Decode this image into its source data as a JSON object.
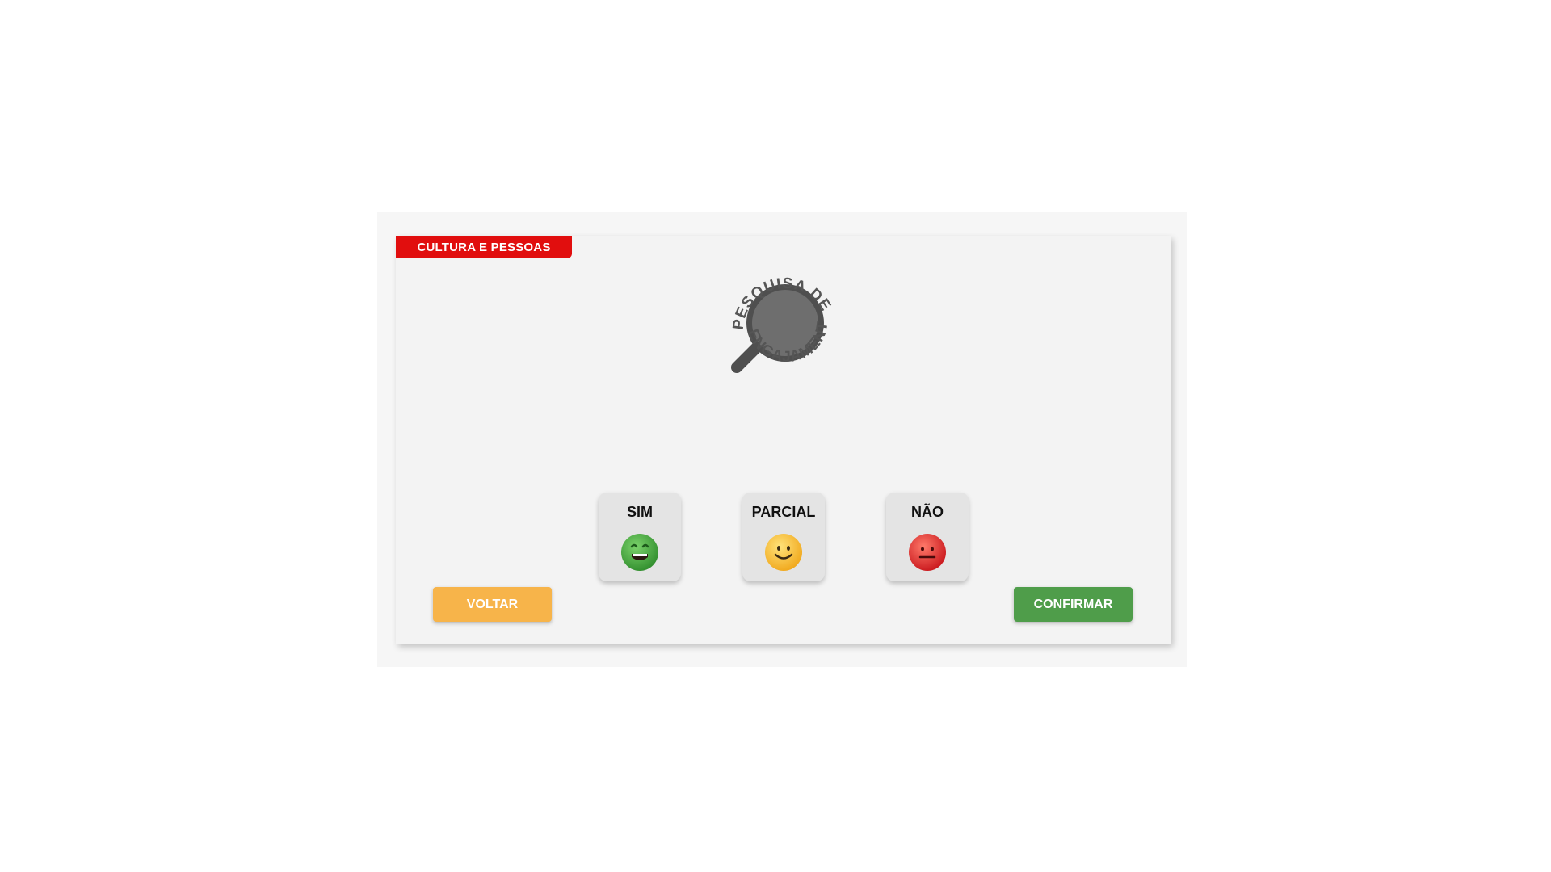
{
  "header": {
    "section_tag": "CULTURA E PESSOAS",
    "tag_color": "#e10e0e"
  },
  "logo": {
    "text_top": "PESQUISA DE",
    "text_bottom": "ENGAJAMENTO",
    "icon": "magnifier-icon",
    "color": "#5a5a5a"
  },
  "options": [
    {
      "label": "SIM",
      "icon": "happy-green-face-icon",
      "color": "#3aa23a"
    },
    {
      "label": "PARCIAL",
      "icon": "smiling-yellow-face-icon",
      "color": "#f5b82a"
    },
    {
      "label": "NÃO",
      "icon": "neutral-red-face-icon",
      "color": "#e2262b"
    }
  ],
  "actions": {
    "back_label": "VOLTAR",
    "back_color": "#f7b44a",
    "confirm_label": "CONFIRMAR",
    "confirm_color": "#4f9d4a"
  }
}
